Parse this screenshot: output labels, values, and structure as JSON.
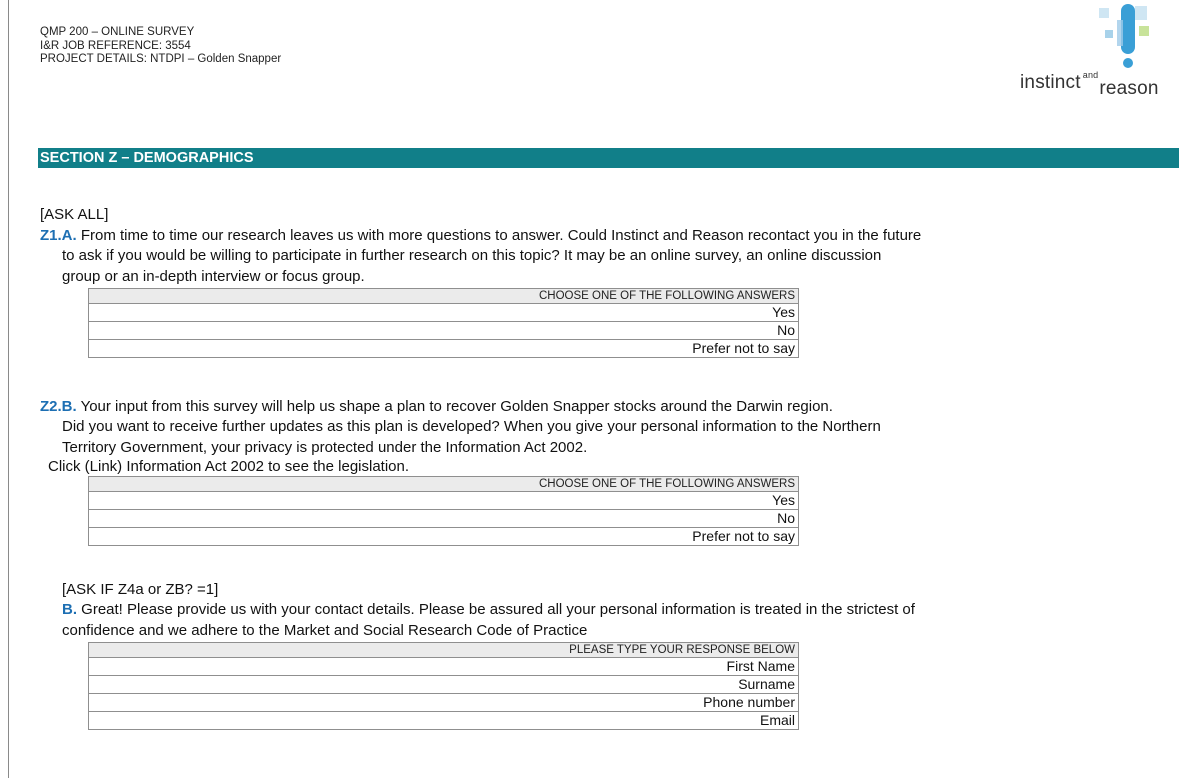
{
  "header": {
    "line1": "QMP 200 – ONLINE SURVEY",
    "line2": "I&R JOB REFERENCE: 3554",
    "line3": "PROJECT DETAILS: NTDPI – Golden Snapper"
  },
  "logo": {
    "main": "instinct",
    "and": "and",
    "reason": "reason"
  },
  "colors": {
    "section_bar": "#117f89",
    "question_number": "#1d6fb3",
    "table_header": "#ebebeb"
  },
  "section": {
    "title": "SECTION Z – DEMOGRAPHICS"
  },
  "q1": {
    "instruction": "[ASK ALL]",
    "number": "Z1.A.",
    "line1": " From time to time our research leaves us with more questions to answer. Could Instinct and Reason recontact you in the future",
    "line2": "to ask if you would be willing to participate in further research on this topic? It may be an online survey, an online discussion",
    "line3": "group or an in-depth interview or focus group.",
    "table_header": "CHOOSE ONE OF THE FOLLOWING ANSWERS",
    "options": [
      "Yes",
      "No",
      "Prefer not to say"
    ]
  },
  "q2": {
    "number": "Z2.B.",
    "line1": " Your input from this survey will help us shape a plan to recover Golden Snapper stocks around the Darwin region.",
    "line2": "Did you want to receive further updates as this plan is developed? When you give your personal information to the Northern",
    "line3": "Territory Government, your privacy is protected under the Information Act 2002.",
    "line4": "Click (Link)  Information Act 2002 to see the legislation.",
    "table_header": "CHOOSE ONE OF THE FOLLOWING ANSWERS",
    "options": [
      "Yes",
      "No",
      "Prefer not to say"
    ]
  },
  "q3": {
    "instruction": "[ASK IF Z4a or ZB? =1]",
    "number": "B.",
    "line1": " Great! Please provide us with your contact details. Please be assured all your personal information is treated in the strictest of",
    "line2": "confidence and we adhere to the Market and Social Research Code of Practice",
    "table_header": "PLEASE TYPE YOUR RESPONSE BELOW",
    "fields": [
      "First Name",
      "Surname",
      "Phone number",
      "Email"
    ]
  }
}
